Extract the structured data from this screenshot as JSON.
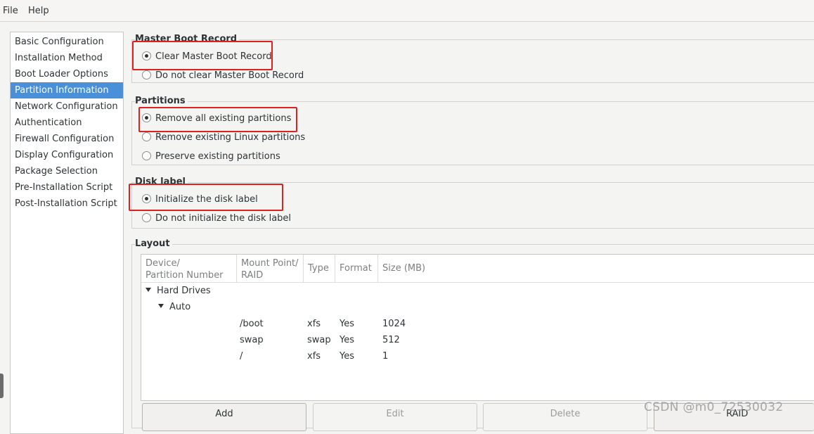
{
  "menu": [
    "File",
    "Help"
  ],
  "sidebar": {
    "items": [
      {
        "label": "Basic Configuration"
      },
      {
        "label": "Installation Method"
      },
      {
        "label": "Boot Loader Options"
      },
      {
        "label": "Partition Information"
      },
      {
        "label": "Network Configuration"
      },
      {
        "label": "Authentication"
      },
      {
        "label": "Firewall Configuration"
      },
      {
        "label": "Display Configuration"
      },
      {
        "label": "Package Selection"
      },
      {
        "label": "Pre-Installation Script"
      },
      {
        "label": "Post-Installation Script"
      }
    ],
    "selected": "Partition Information"
  },
  "mbr": {
    "title": "Master Boot Record",
    "options": [
      {
        "label": "Clear Master Boot Record",
        "checked": true
      },
      {
        "label": "Do not clear Master Boot Record",
        "checked": false
      }
    ]
  },
  "partitions": {
    "title": "Partitions",
    "options": [
      {
        "label": "Remove all existing partitions",
        "checked": true
      },
      {
        "label": "Remove existing Linux partitions",
        "checked": false
      },
      {
        "label": "Preserve existing partitions",
        "checked": false
      }
    ]
  },
  "disk_label": {
    "title": "Disk label",
    "options": [
      {
        "label": "Initialize the disk label",
        "checked": true
      },
      {
        "label": "Do not initialize the disk label",
        "checked": false
      }
    ]
  },
  "layout": {
    "title": "Layout",
    "columns": [
      {
        "line1": "Device/",
        "line2": "Partition Number"
      },
      {
        "line1": "Mount Point/",
        "line2": "RAID"
      },
      {
        "line1": "Type",
        "line2": ""
      },
      {
        "line1": "Format",
        "line2": ""
      },
      {
        "line1": "Size (MB)",
        "line2": ""
      }
    ],
    "tree": {
      "root": "Hard Drives",
      "child": "Auto"
    },
    "rows": [
      {
        "mount": "/boot",
        "type": "xfs",
        "format": "Yes",
        "size": "1024"
      },
      {
        "mount": "swap",
        "type": "swap",
        "format": "Yes",
        "size": "512"
      },
      {
        "mount": "/",
        "type": "xfs",
        "format": "Yes",
        "size": "1"
      }
    ]
  },
  "buttons": {
    "add": "Add",
    "edit": "Edit",
    "delete": "Delete",
    "raid": "RAID"
  },
  "watermark": "CSDN @m0_72530032",
  "colors": {
    "selection": "#4a90d9",
    "highlight": "#e0201f"
  }
}
